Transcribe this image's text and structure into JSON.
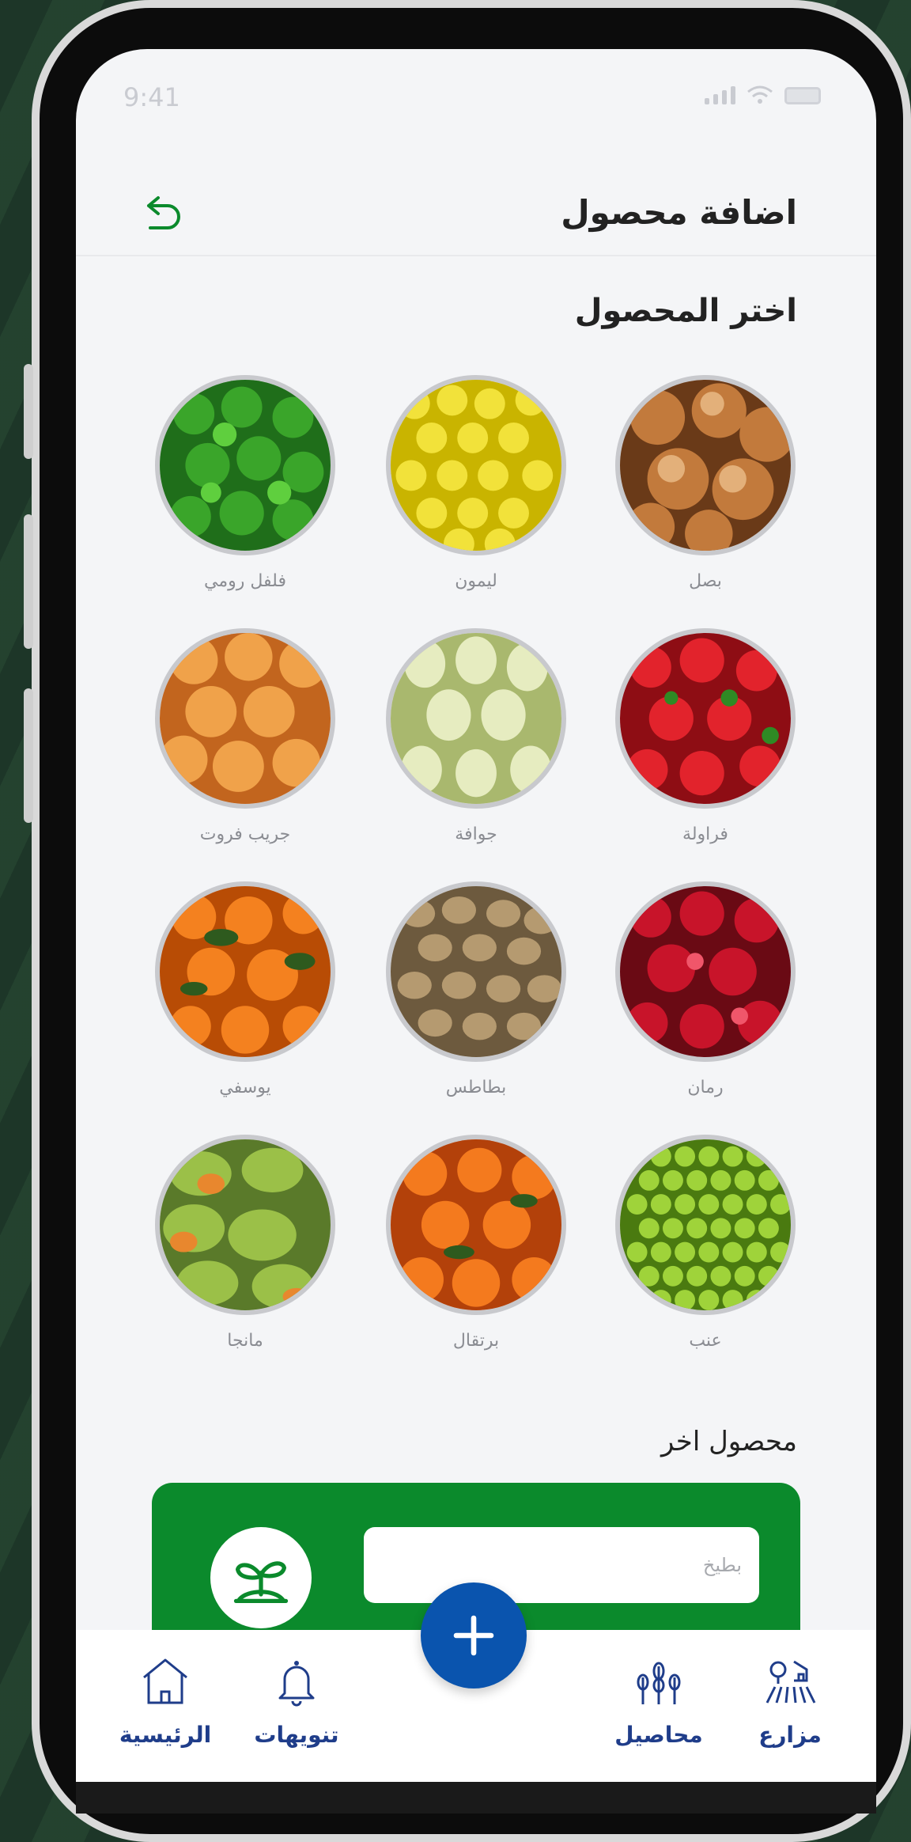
{
  "status_bar": {
    "time": "9:41"
  },
  "header": {
    "title": "اضافة محصول",
    "back_icon": "back-arrow-icon"
  },
  "section_title": "اختر المحصول",
  "crops": [
    {
      "label": "فلفل رومي"
    },
    {
      "label": "ليمون"
    },
    {
      "label": "بصل"
    },
    {
      "label": "جريب فروت"
    },
    {
      "label": "جوافة"
    },
    {
      "label": "فراولة"
    },
    {
      "label": "يوسفي"
    },
    {
      "label": "بطاطس"
    },
    {
      "label": "رمان"
    },
    {
      "label": "مانجا"
    },
    {
      "label": "برتقال"
    },
    {
      "label": "عنب"
    }
  ],
  "other": {
    "title": "محصول اخر",
    "input_placeholder": "بطيخ",
    "icon": "sprout-icon"
  },
  "tab_bar": {
    "home": "الرئيسية",
    "notifications": "تنويهات",
    "crops": "محاصيل",
    "farms": "مزارع",
    "add_icon": "plus-icon"
  },
  "colors": {
    "accent_green": "#0b8a2c",
    "fab_blue": "#0a54ae",
    "tab_label": "#1f3d8a"
  }
}
